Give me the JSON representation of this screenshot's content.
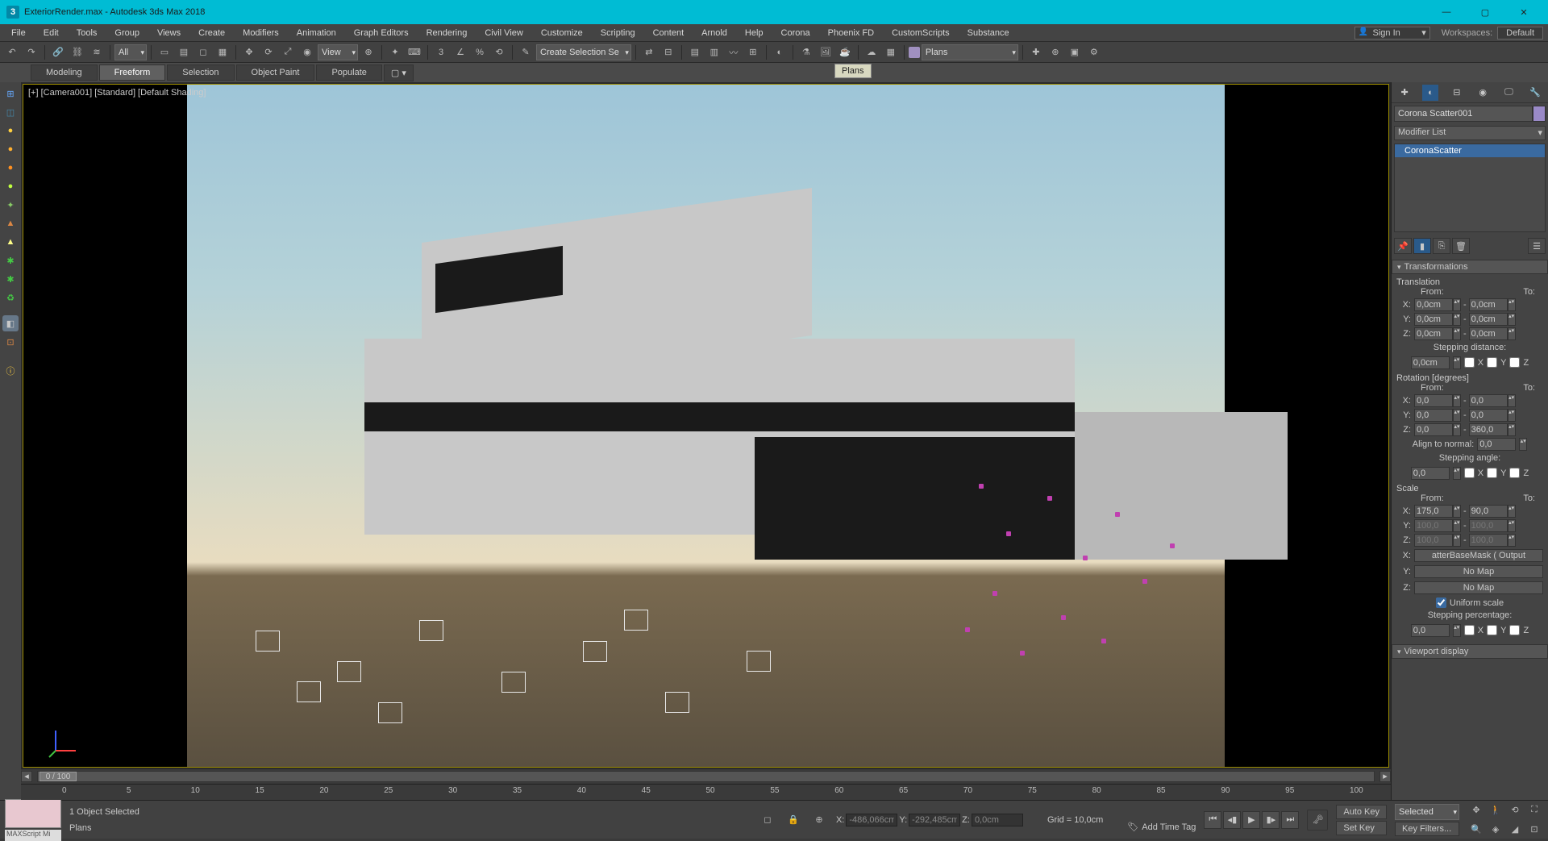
{
  "titlebar": {
    "filename": "ExteriorRender.max - Autodesk 3ds Max 2018"
  },
  "menu": {
    "items": [
      "File",
      "Edit",
      "Tools",
      "Group",
      "Views",
      "Create",
      "Modifiers",
      "Animation",
      "Graph Editors",
      "Rendering",
      "Civil View",
      "Customize",
      "Scripting",
      "Content",
      "Arnold",
      "Help",
      "Corona",
      "Phoenix FD",
      "CustomScripts",
      "Substance"
    ],
    "signin": "Sign In",
    "workspaces_label": "Workspaces:",
    "workspace": "Default"
  },
  "toolbar": {
    "all": "All",
    "view": "View",
    "createSel": "Create Selection Se",
    "layer": "Plans"
  },
  "tooltip": "Plans",
  "ribbon": {
    "tabs": [
      "Modeling",
      "Freeform",
      "Selection",
      "Object Paint",
      "Populate"
    ],
    "active": 1
  },
  "viewport": {
    "label": "[+] [Camera001] [Standard] [Default Shading]"
  },
  "timeline": {
    "thumb": "0 / 100",
    "ticks": [
      "0",
      "5",
      "10",
      "15",
      "20",
      "25",
      "30",
      "35",
      "40",
      "45",
      "50",
      "55",
      "60",
      "65",
      "70",
      "75",
      "80",
      "85",
      "90",
      "95",
      "100"
    ]
  },
  "status": {
    "selected": "1 Object Selected",
    "layer": "Plans",
    "maxscript": "MAXScript Mi",
    "x_lbl": "X:",
    "x": "-486,066cm",
    "y_lbl": "Y:",
    "y": "-292,485cm",
    "z_lbl": "Z:",
    "z": "0,0cm",
    "grid": "Grid = 10,0cm",
    "addtag": "Add Time Tag",
    "autokey": "Auto Key",
    "setkey": "Set Key",
    "selected_filter": "Selected",
    "keyfilters": "Key Filters..."
  },
  "panel": {
    "name": "Corona Scatter001",
    "modlist": "Modifier List",
    "stack_item": "CoronaScatter",
    "rollout_transform": "Transformations",
    "translation": "Translation",
    "from": "From:",
    "to": "To:",
    "tr": {
      "xf": "0,0cm",
      "xt": "0,0cm",
      "yf": "0,0cm",
      "yt": "0,0cm",
      "zf": "0,0cm",
      "zt": "0,0cm"
    },
    "stepdist_lbl": "Stepping distance:",
    "stepdist": "0,0cm",
    "xchk": "X",
    "ychk": "Y",
    "zchk": "Z",
    "rotation": "Rotation [degrees]",
    "ro": {
      "xf": "0,0",
      "xt": "0,0",
      "yf": "0,0",
      "yt": "0,0",
      "zf": "0,0",
      "zt": "360,0"
    },
    "align_lbl": "Align to normal:",
    "align": "0,0",
    "stepang_lbl": "Stepping angle:",
    "stepang": "0,0",
    "scale": "Scale",
    "sc": {
      "xf": "175,0",
      "xt": "90,0",
      "yf": "100,0",
      "yt": "100,0",
      "zf": "100,0",
      "zt": "100,0"
    },
    "mapx": "atterBaseMask  ( Output",
    "mapy": "No Map",
    "mapz": "No Map",
    "uniform": "Uniform scale",
    "steppct_lbl": "Stepping percentage:",
    "steppct": "0,0",
    "next_rollout": "Viewport display"
  }
}
